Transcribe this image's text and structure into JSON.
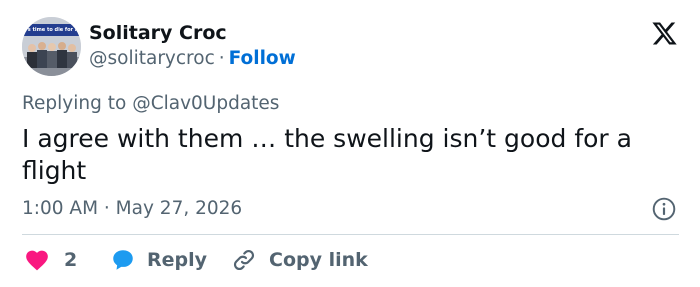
{
  "author": {
    "name": "Solitary Croc",
    "handle": "@solitarycroc",
    "separator": "·",
    "follow_label": "Follow",
    "avatar_banner_text": "It's time to die for Israel"
  },
  "reply_to": {
    "prefix": "Replying to ",
    "handle": "@Clav0Updates"
  },
  "tweet": {
    "text": "I agree with them … the swelling isn’t good for a flight",
    "timestamp": "1:00 AM · May 27, 2026"
  },
  "actions": {
    "like_count": "2",
    "reply_label": "Reply",
    "copy_link_label": "Copy link"
  },
  "colors": {
    "text": "#0f1419",
    "secondary": "#536471",
    "link_blue": "#006fd6",
    "heart": "#f91880",
    "reply_bubble": "#1d9bf0",
    "divider": "#cfd9de"
  },
  "icons": {
    "platform": "x-logo-icon",
    "info": "info-icon",
    "like": "heart-icon",
    "reply": "speech-bubble-icon",
    "copy": "link-icon"
  }
}
